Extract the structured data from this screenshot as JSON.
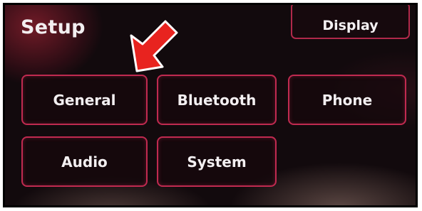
{
  "screen": {
    "title": "Setup"
  },
  "header": {
    "display_label": "Display"
  },
  "menu": {
    "items": [
      {
        "label": "General"
      },
      {
        "label": "Bluetooth"
      },
      {
        "label": "Phone"
      },
      {
        "label": "Audio"
      },
      {
        "label": "System"
      }
    ]
  },
  "colors": {
    "accent_border": "#c02a50",
    "arrow": "#e8231f",
    "text": "#f3eff1"
  },
  "icons": {
    "pointer": "red-arrow-icon"
  }
}
